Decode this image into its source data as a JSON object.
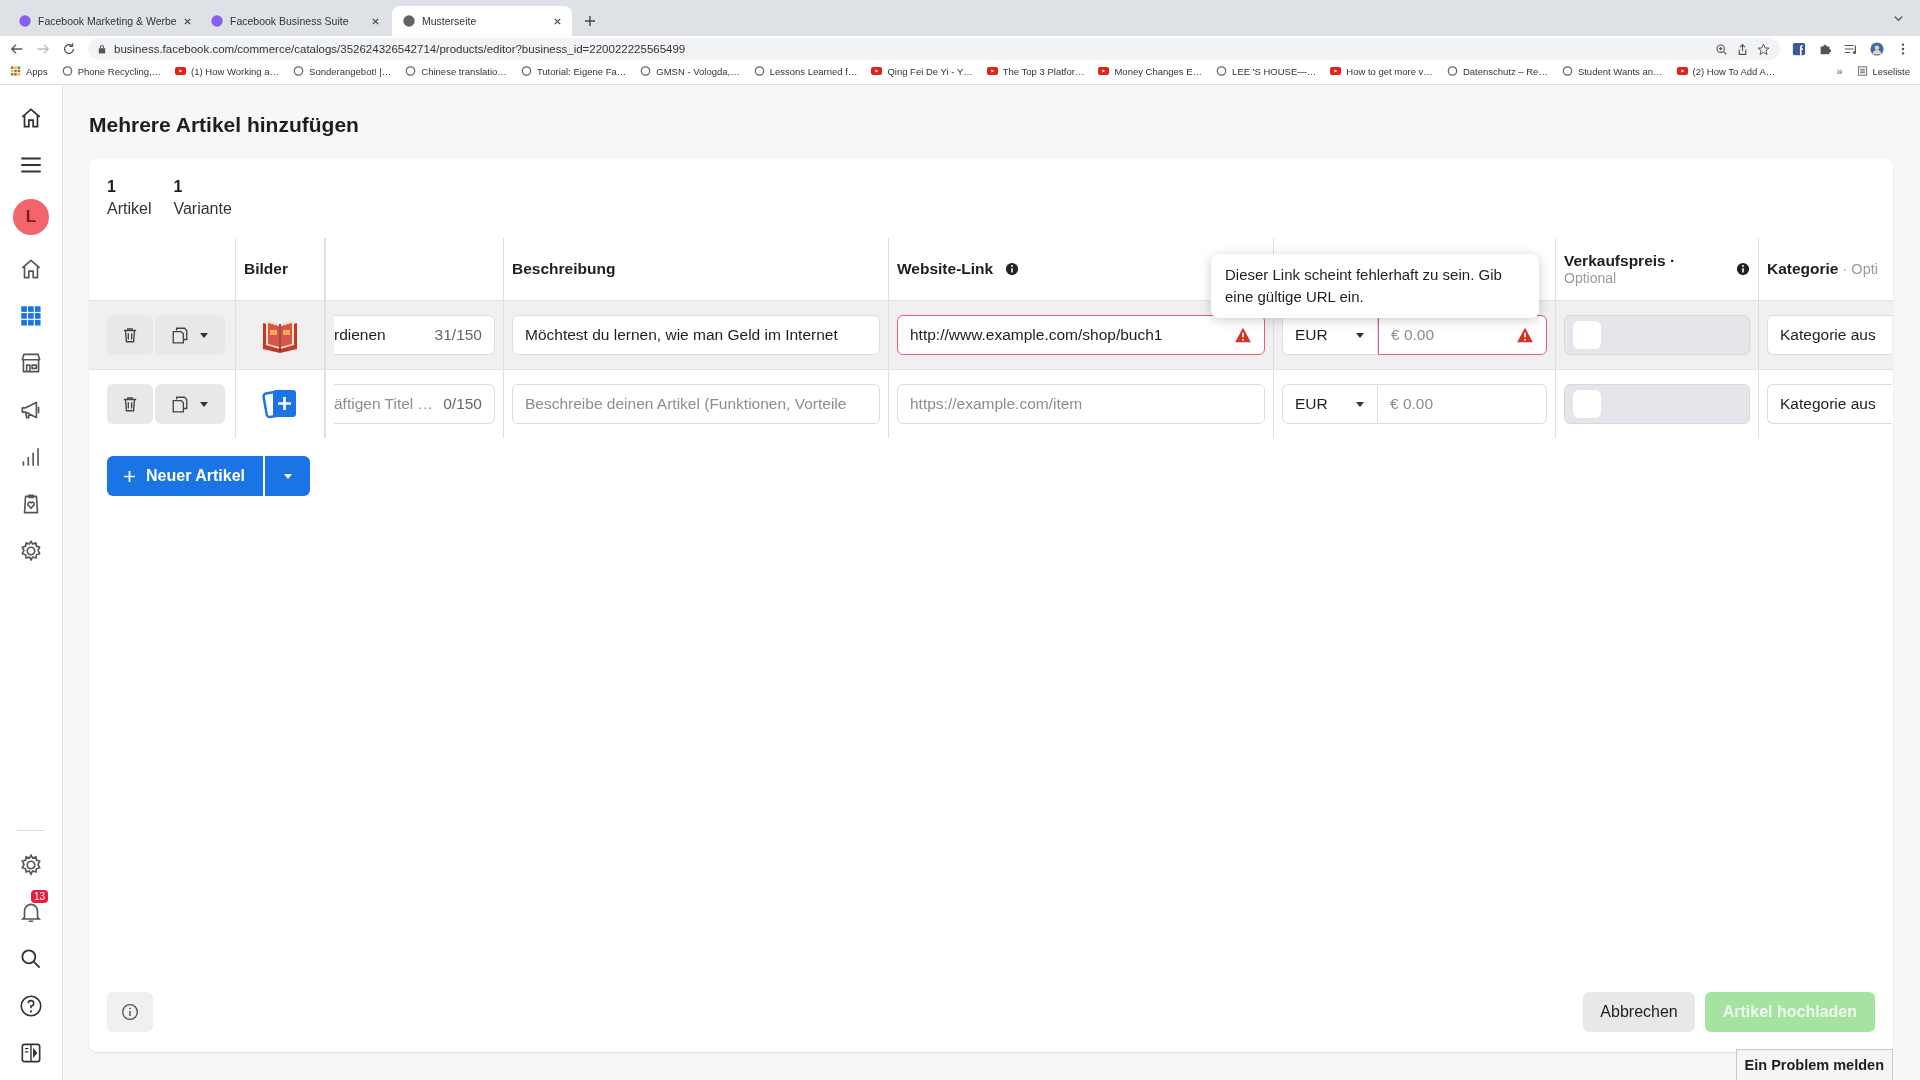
{
  "browser": {
    "tabs": [
      {
        "title": "Facebook Marketing & Werbe",
        "selected": false
      },
      {
        "title": "Facebook Business Suite",
        "selected": false
      },
      {
        "title": "Musterseite",
        "selected": true
      }
    ],
    "address": "business.facebook.com/commerce/catalogs/352624326542714/products/editor?business_id=220022225565499",
    "apps": "Apps",
    "bookmarks": [
      {
        "label": "Phone Recycling,…",
        "kind": "site"
      },
      {
        "label": "(1) How Working a…",
        "kind": "video"
      },
      {
        "label": "Sonderangebot! |…",
        "kind": "site"
      },
      {
        "label": "Chinese translatio…",
        "kind": "site"
      },
      {
        "label": "Tutorial: Eigene Fa…",
        "kind": "site"
      },
      {
        "label": "GMSN - Vologda,…",
        "kind": "site"
      },
      {
        "label": "Lessons Learned f…",
        "kind": "site"
      },
      {
        "label": "Qing Fei De Yi - Y…",
        "kind": "video"
      },
      {
        "label": "The Top 3 Platfor…",
        "kind": "video"
      },
      {
        "label": "Money Changes E…",
        "kind": "video"
      },
      {
        "label": "LEE 'S HOUSE—…",
        "kind": "site"
      },
      {
        "label": "How to get more v…",
        "kind": "video"
      },
      {
        "label": "Datenschutz – Re…",
        "kind": "site"
      },
      {
        "label": "Student Wants an…",
        "kind": "site"
      },
      {
        "label": "(2) How To Add A…",
        "kind": "video"
      }
    ],
    "more": "»",
    "reading_list": "Leseliste"
  },
  "sidebar": {
    "avatar": "L",
    "items": [
      {
        "selected": false
      },
      {
        "selected": true
      },
      {
        "selected": false
      },
      {
        "selected": false
      },
      {
        "selected": false
      },
      {
        "selected": false
      },
      {
        "selected": false
      }
    ],
    "notifications": "13"
  },
  "page_title": "Mehrere Artikel hinzufügen",
  "counts": [
    {
      "value": "1",
      "label": "Artikel"
    },
    {
      "value": "1",
      "label": "Variante"
    }
  ],
  "table": {
    "headers": {
      "images": "Bilder",
      "description": "Beschreibung",
      "website_link": "Website-Link",
      "sale_price": "Verkaufspreis ·",
      "sale_price_note": "Optional",
      "category": "Kategorie",
      "category_note": "· Opti"
    },
    "rows": [
      {
        "highlighted": true,
        "kind": "book",
        "title_value": "rdienen",
        "title_count": "31/150",
        "description_value": "Möchtest du lernen, wie man Geld im Internet",
        "link_value": "http://www.example.com/shop/buch1",
        "link_error": true,
        "currency": "EUR",
        "price_placeholder": "€ 0.00",
        "price_error": true,
        "sale_checked": false,
        "category_placeholder": "Kategorie aus"
      },
      {
        "highlighted": false,
        "kind": "add",
        "title_placeholder": "äftigen Titel …",
        "title_count": "0/150",
        "description_placeholder": "Beschreibe deinen Artikel (Funktionen, Vorteile",
        "link_placeholder": "https://example.com/item",
        "link_error": false,
        "currency": "EUR",
        "price_placeholder": "€ 0.00",
        "price_error": false,
        "sale_checked": false,
        "category_placeholder": "Kategorie aus"
      }
    ]
  },
  "tooltip": "Dieser Link scheint fehlerhaft zu sein. Gib eine gültige URL ein.",
  "new_article": "Neuer Artikel",
  "cancel": "Abbrechen",
  "upload": {
    "label": "Artikel hochladen",
    "disabled": true
  },
  "report": "Ein Problem melden"
}
